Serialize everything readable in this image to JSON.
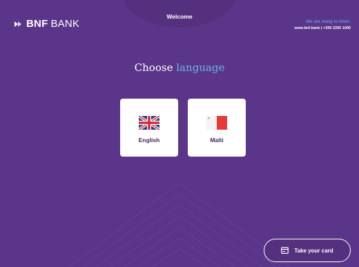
{
  "header": {
    "welcome": "Welcome",
    "logo": {
      "bold": "BNF",
      "light": "BANK"
    },
    "tagline": "We are ready to listen.",
    "contact": "www.bnf.bank | +356 2260 1000"
  },
  "main": {
    "heading_part1": "Choose",
    "heading_part2": "language",
    "languages": [
      {
        "label": "English",
        "flag": "uk-flag-icon"
      },
      {
        "label": "Malti",
        "flag": "malta-flag-icon"
      }
    ]
  },
  "footer": {
    "take_card_label": "Take your card",
    "take_card_icon": "card-icon"
  },
  "colors": {
    "background": "#5b3589",
    "accent": "#6fb2e6",
    "card": "#ffffff"
  }
}
